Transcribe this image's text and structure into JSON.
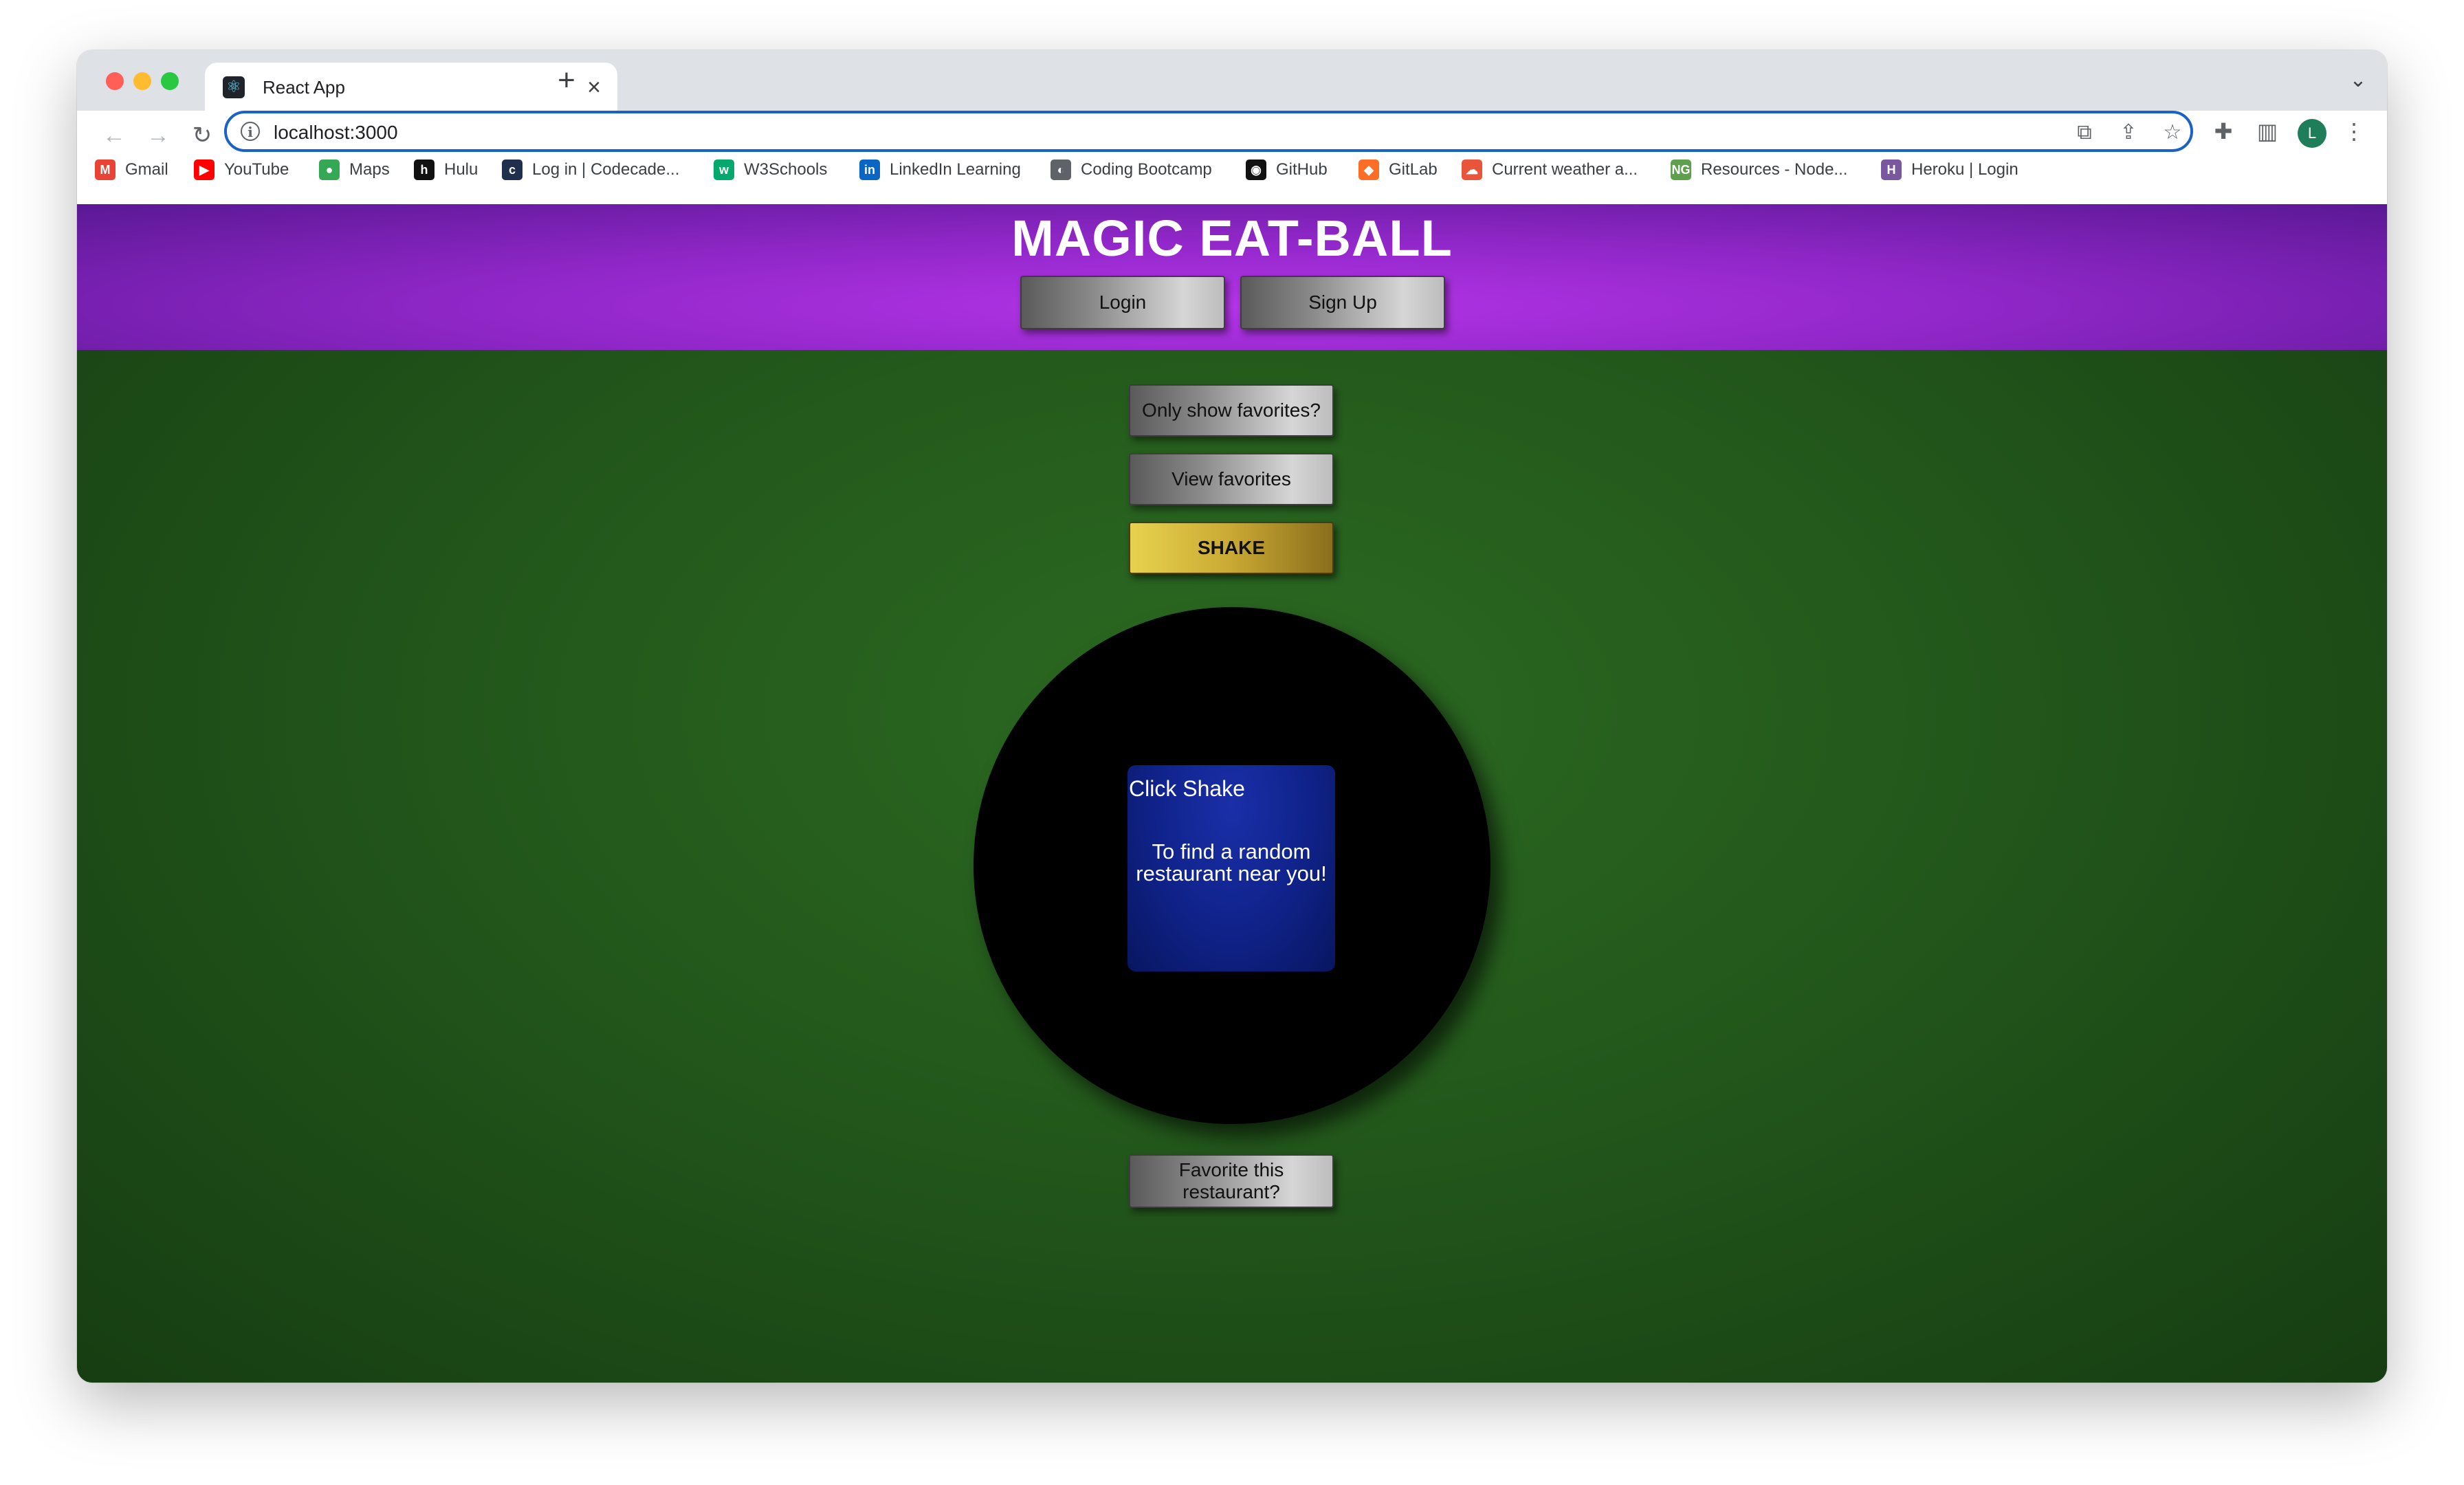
{
  "browser": {
    "tab": {
      "title": "React App",
      "favicon": "react-logo-icon",
      "close": "×"
    },
    "new_tab": "+",
    "tab_search": "⌄",
    "nav": {
      "back": "←",
      "forward": "→",
      "reload": "↻"
    },
    "address": {
      "url": "localhost:3000",
      "info": "i"
    },
    "omnibox_icons": {
      "open_in_app": "⧉",
      "share": "⇪",
      "bookmark": "☆"
    },
    "toolbar_icons": {
      "extensions": "✚",
      "side_panel": "▥",
      "menu": "⋮"
    },
    "profile_initial": "L",
    "bookmarks": [
      {
        "label": "Gmail",
        "icon": "gmail-icon",
        "glyph": "M",
        "color": "#ea4335"
      },
      {
        "label": "YouTube",
        "icon": "youtube-icon",
        "glyph": "▶",
        "color": "#ff0000"
      },
      {
        "label": "Maps",
        "icon": "maps-pin-icon",
        "glyph": "●",
        "color": "#34a853"
      },
      {
        "label": "Hulu",
        "icon": "hulu-icon",
        "glyph": "h",
        "color": "#111111"
      },
      {
        "label": "Log in | Codecade...",
        "icon": "codecademy-icon",
        "glyph": "c",
        "color": "#1f2f4d"
      },
      {
        "label": "W3Schools",
        "icon": "w3schools-icon",
        "glyph": "w",
        "color": "#04aa6d"
      },
      {
        "label": "LinkedIn Learning",
        "icon": "linkedin-icon",
        "glyph": "in",
        "color": "#0a66c2"
      },
      {
        "label": "Coding Bootcamp",
        "icon": "globe-icon",
        "glyph": "◐",
        "color": "#5f6368"
      },
      {
        "label": "GitHub",
        "icon": "github-icon",
        "glyph": "◉",
        "color": "#111111"
      },
      {
        "label": "GitLab",
        "icon": "gitlab-icon",
        "glyph": "◆",
        "color": "#fc6d26"
      },
      {
        "label": "Current weather a...",
        "icon": "weather-icon",
        "glyph": "☁",
        "color": "#e8553a"
      },
      {
        "label": "Resources - Node...",
        "icon": "node-icon",
        "glyph": "NG",
        "color": "#5fa04e"
      },
      {
        "label": "Heroku | Login",
        "icon": "heroku-icon",
        "glyph": "H",
        "color": "#79589f"
      }
    ]
  },
  "app": {
    "title": "MAGIC EAT-BALL",
    "header_buttons": {
      "login": "Login",
      "signup": "Sign Up"
    },
    "controls": {
      "only_favorites": "Only show favorites?",
      "view_favorites": "View favorites",
      "shake": "SHAKE"
    },
    "ball": {
      "heading": "Click Shake",
      "message": "To find a random restaurant near you!"
    },
    "favorite_button": "Favorite this restaurant?"
  }
}
